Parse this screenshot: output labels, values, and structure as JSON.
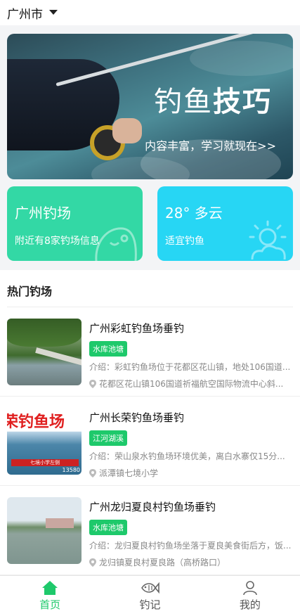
{
  "header": {
    "city": "广州市"
  },
  "banner": {
    "title_regular": "钓鱼",
    "title_bold": "技巧",
    "subtitle": "内容丰富，学习就现在>>"
  },
  "cards": [
    {
      "title": "广州钓场",
      "subtitle": "附近有8家钓场信息",
      "color": "#33d8a5",
      "icon": "fish-icon"
    },
    {
      "title": "28° 多云",
      "subtitle": "适宜钓鱼",
      "color": "#27d6f4",
      "icon": "sun-cloud-icon"
    }
  ],
  "section": {
    "title": "热门钓场"
  },
  "spots": [
    {
      "name": "广州彩虹钓鱼场垂钓",
      "tag": "水库池塘",
      "intro": "介绍：彩虹钓鱼场位于花都区花山镇，地处106国道...",
      "address": "花都区花山镇106国道祈福航空国际物流中心斜..."
    },
    {
      "name": "广州长荣钓鱼场垂钓",
      "tag": "江河湖溪",
      "intro": "介绍：荣山泉水钓鱼场环境优美，离白水寨仅15分...",
      "address": "派潭镇七境小学",
      "thumb_text": "荣钓鱼场",
      "thumb_caption": "七境小学左侧",
      "thumb_phone": "13580"
    },
    {
      "name": "广州龙归夏良村钓鱼场垂钓",
      "tag": "水库池塘",
      "intro": "介绍：龙归夏良村钓鱼场坐落于夏良美食街后方，饭...",
      "address": "龙归镇夏良村夏良路（高桥路口）"
    }
  ],
  "tabbar": [
    {
      "label": "首页",
      "icon": "home-icon",
      "active": true
    },
    {
      "label": "钓记",
      "icon": "fish-outline-icon",
      "active": false
    },
    {
      "label": "我的",
      "icon": "user-icon",
      "active": false
    }
  ],
  "colors": {
    "accent": "#1ec96b",
    "card_green": "#33d8a5",
    "card_blue": "#27d6f4"
  }
}
